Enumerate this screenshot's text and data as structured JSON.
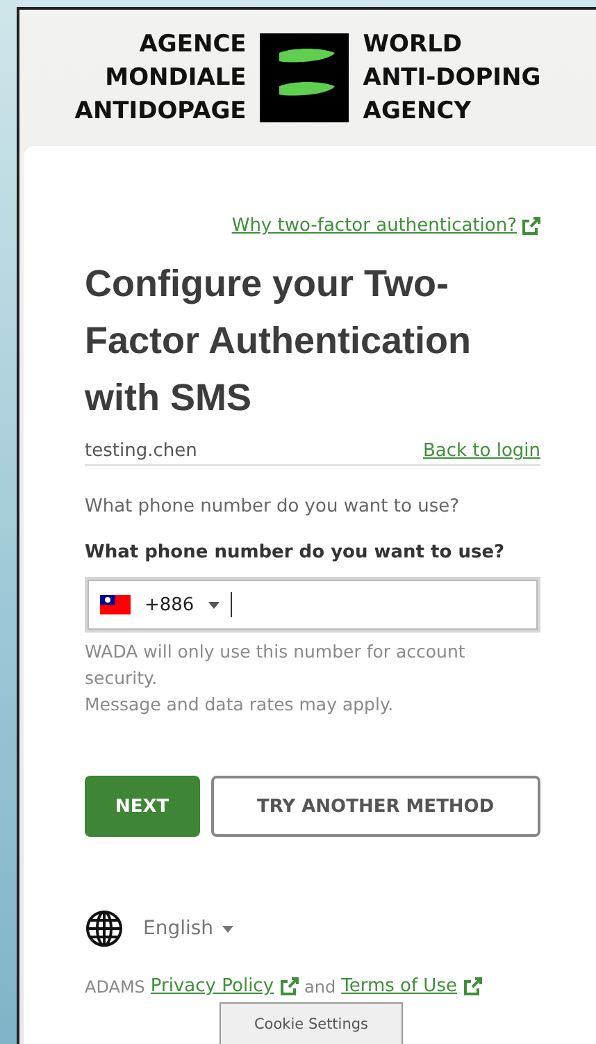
{
  "logo": {
    "left_lines": [
      "AGENCE",
      "MONDIALE",
      "ANTIDOPAGE"
    ],
    "right_lines": [
      "WORLD",
      "ANTI-DOPING",
      "AGENCY"
    ]
  },
  "help_link": "Why two-factor authentication?",
  "title": "Configure your Two-Factor Authentication with SMS",
  "username": "testing.chen",
  "back_link": "Back to login",
  "question": "What phone number do you want to use?",
  "phone_field": {
    "label": "What phone number do you want to use?",
    "dial_code": "+886",
    "focused": true
  },
  "hints": [
    "WADA will only use this number for account security.",
    "Message and data rates may apply."
  ],
  "buttons": [
    {
      "label": "NEXT",
      "kind": "primary"
    },
    {
      "label": "TRY ANOTHER METHOD",
      "kind": "secondary"
    }
  ],
  "language": "English",
  "footer": {
    "prefix": "ADAMS",
    "privacy_link": "Privacy Policy",
    "joiner": "and",
    "terms_link": "Terms of Use"
  },
  "cookie_button": "Cookie Settings"
}
